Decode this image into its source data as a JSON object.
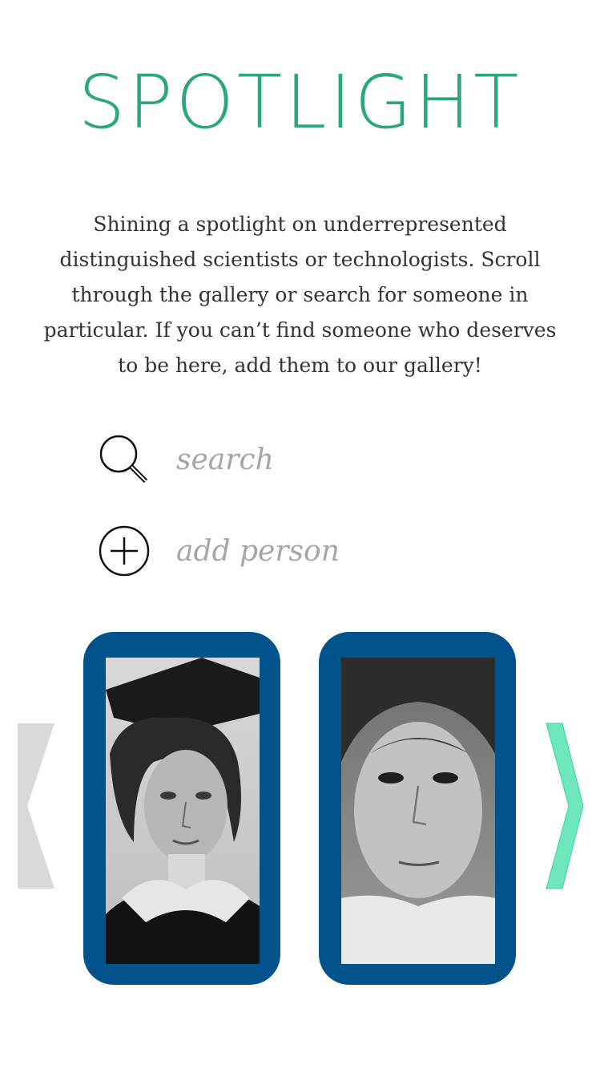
{
  "header": {
    "title": "SPOTLIGHT"
  },
  "intro": {
    "text": "Shining a spotlight on underrepresented distinguished scientists or technologists. Scroll through the gallery or search for someone in particular. If you can’t find someone who deserves to be here, add them to our gallery!"
  },
  "actions": {
    "search_label": "search",
    "add_label": "add person"
  },
  "gallery": {
    "prev_icon": "chevron-left-icon",
    "next_icon": "chevron-right-icon",
    "cards": [
      {
        "portrait": "woman in graduation cap and gown, black-and-white photo"
      },
      {
        "portrait": "woman with dark hair pulled back, black-and-white photo"
      }
    ]
  },
  "colors": {
    "title": "#2aa87a",
    "card_frame": "#02538b",
    "arrow_prev": "#d9d9d9",
    "arrow_next": "#6ee8ba",
    "label_gray": "#a6a6a6",
    "body_text": "#333333"
  }
}
